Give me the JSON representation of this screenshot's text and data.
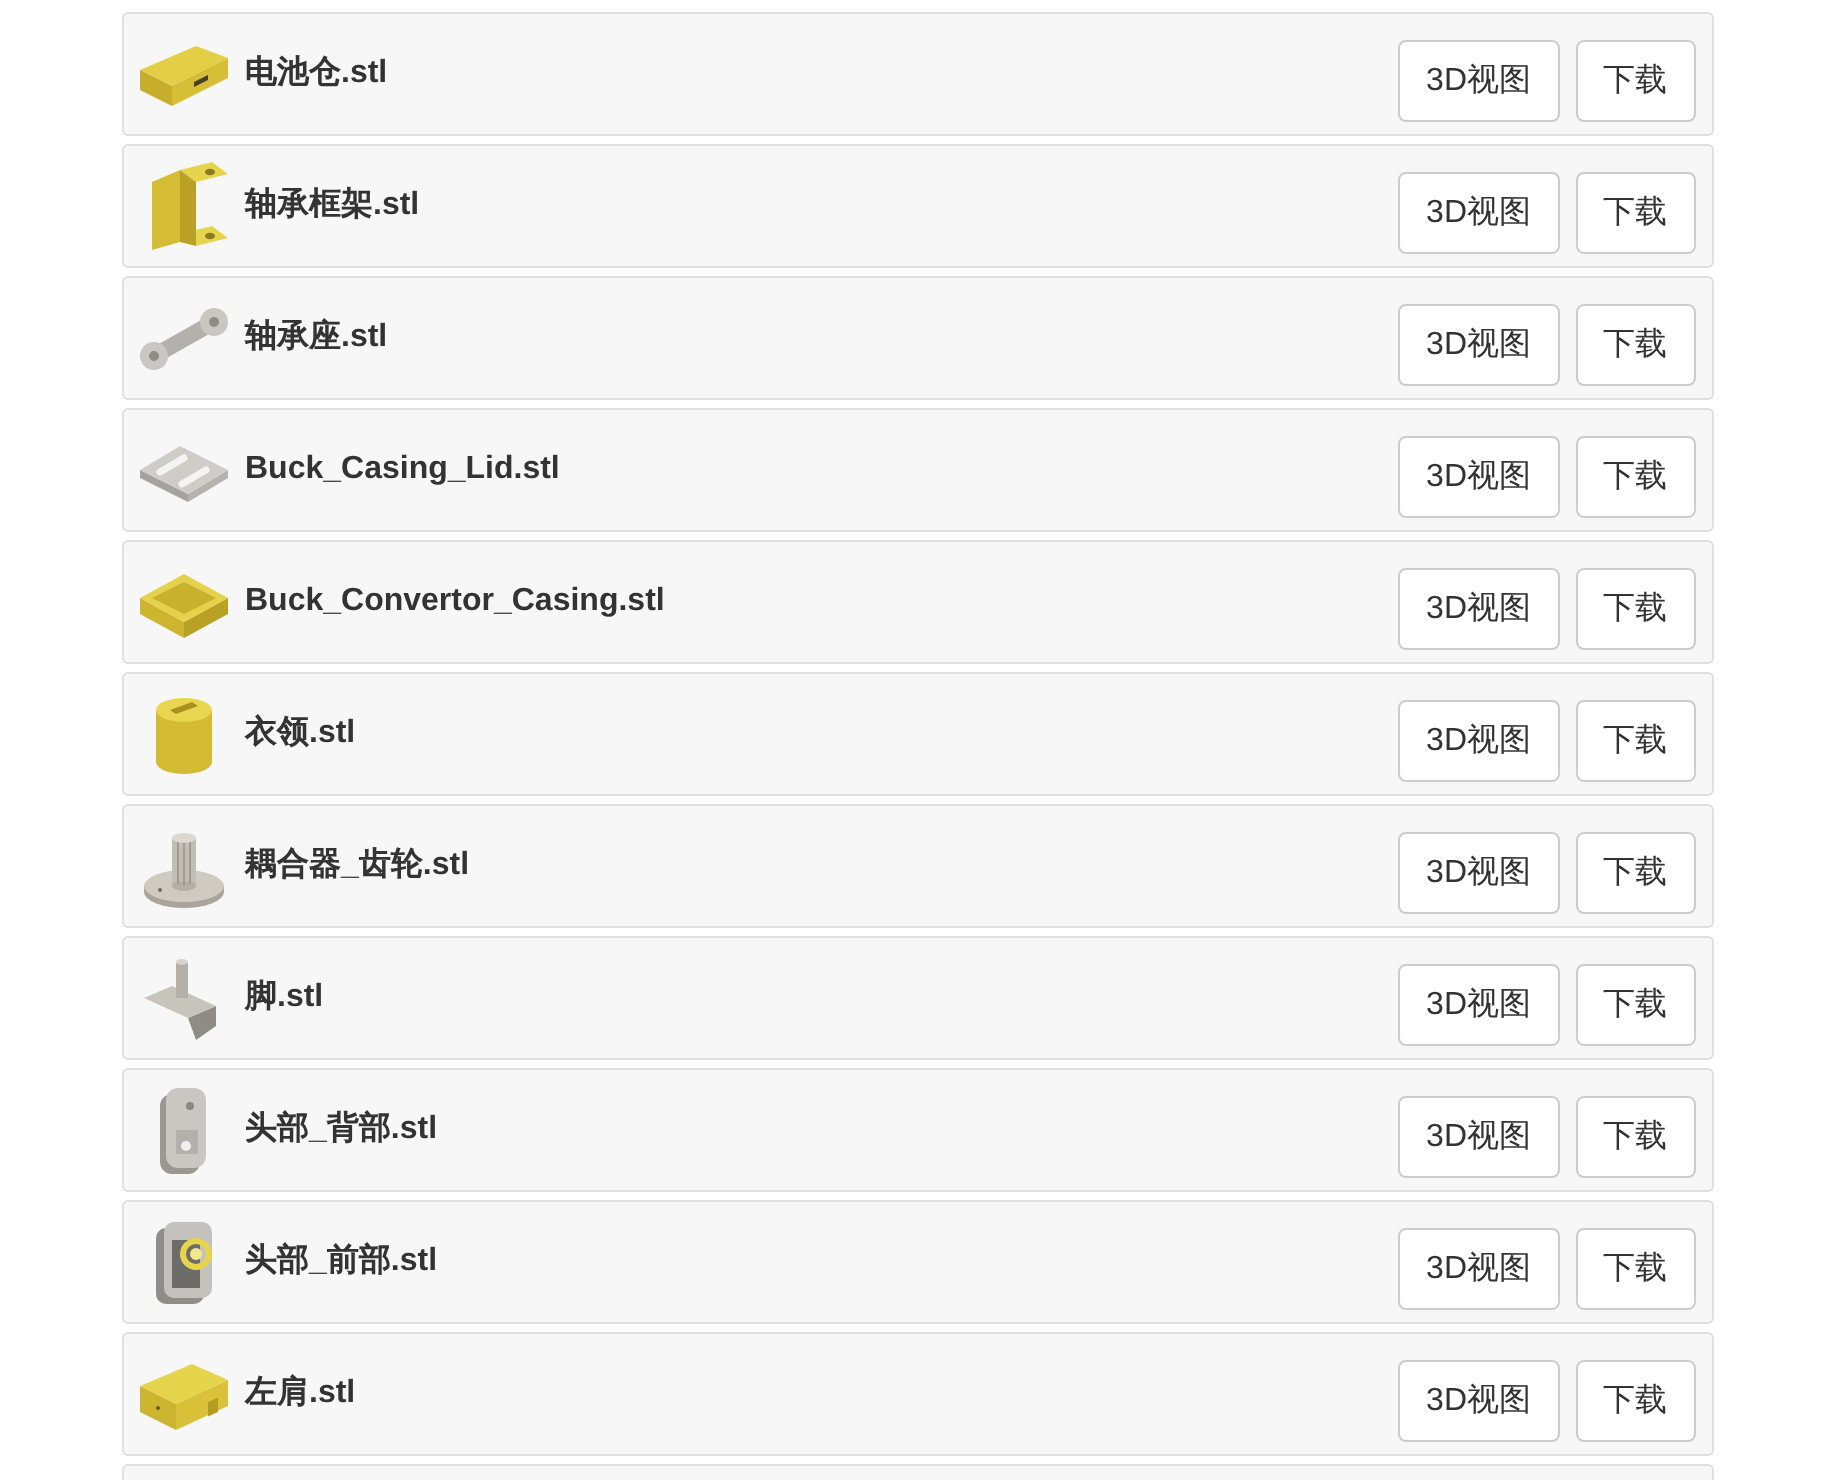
{
  "files": [
    {
      "name": "电池仓.stl",
      "buttons": [
        "3D视图",
        "下载"
      ]
    },
    {
      "name": "轴承框架.stl",
      "buttons": [
        "3D视图",
        "下载"
      ]
    },
    {
      "name": "轴承座.stl",
      "buttons": [
        "3D视图",
        "下载"
      ]
    },
    {
      "name": "Buck_Casing_Lid.stl",
      "buttons": [
        "3D视图",
        "下载"
      ]
    },
    {
      "name": "Buck_Convertor_Casing.stl",
      "buttons": [
        "3D视图",
        "下载"
      ]
    },
    {
      "name": "衣领.stl",
      "buttons": [
        "3D视图",
        "下载"
      ]
    },
    {
      "name": "耦合器_齿轮.stl",
      "buttons": [
        "3D视图",
        "下载"
      ]
    },
    {
      "name": "脚.stl",
      "buttons": [
        "3D视图",
        "下载"
      ]
    },
    {
      "name": "头部_背部.stl",
      "buttons": [
        "3D视图",
        "下载"
      ]
    },
    {
      "name": "头部_前部.stl",
      "buttons": [
        "3D视图",
        "下载"
      ]
    },
    {
      "name": "左肩.stl",
      "buttons": [
        "3D视图",
        "下载"
      ]
    }
  ]
}
